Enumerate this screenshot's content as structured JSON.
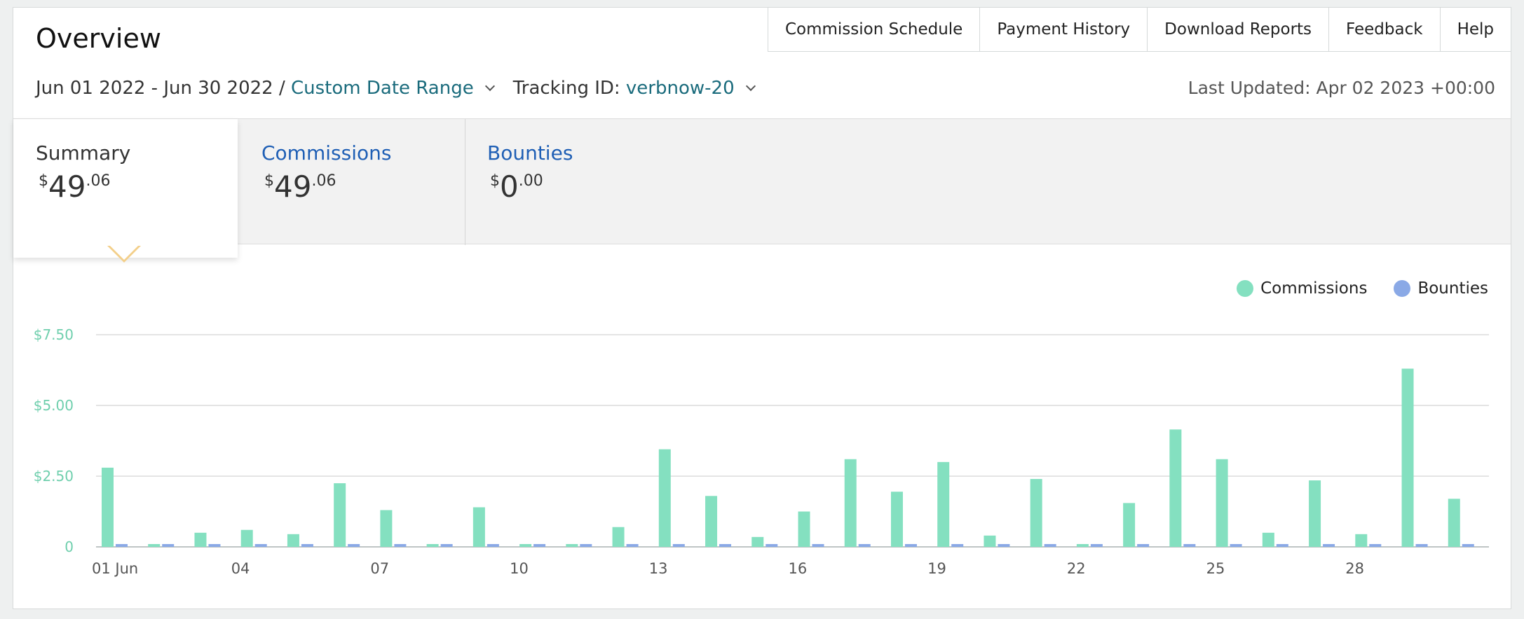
{
  "header": {
    "title": "Overview",
    "nav": [
      "Commission Schedule",
      "Payment History",
      "Download Reports",
      "Feedback",
      "Help"
    ],
    "date_range": "Jun 01 2022 - Jun 30 2022 /",
    "date_mode": "Custom Date Range",
    "tracking_label": "Tracking ID:",
    "tracking_id": "verbnow-20",
    "last_updated": "Last Updated: Apr 02 2023 +00:00"
  },
  "tabs": [
    {
      "label": "Summary",
      "currency": "$",
      "whole": "49",
      "cents": ".06"
    },
    {
      "label": "Commissions",
      "currency": "$",
      "whole": "49",
      "cents": ".06"
    },
    {
      "label": "Bounties",
      "currency": "$",
      "whole": "0",
      "cents": ".00"
    }
  ],
  "legend": {
    "commissions": "Commissions",
    "bounties": "Bounties"
  },
  "colors": {
    "commissions": "#84e0c0",
    "bounties": "#8aa9e6",
    "ytick": "#6fcfad",
    "accent_link": "#1a6b7c"
  },
  "chart_data": {
    "type": "bar",
    "x_labels": {
      "1": "01 Jun",
      "4": "04",
      "7": "07",
      "10": "10",
      "13": "13",
      "16": "16",
      "19": "19",
      "22": "22",
      "25": "25",
      "28": "28"
    },
    "yticks": [
      "0",
      "$2.50",
      "$5.00",
      "$7.50"
    ],
    "ylim": [
      0,
      7.5
    ],
    "series": [
      {
        "name": "Commissions",
        "values": [
          2.8,
          0.1,
          0.5,
          0.6,
          0.45,
          2.25,
          1.3,
          0.1,
          1.4,
          0.1,
          0.1,
          0.7,
          3.45,
          1.8,
          0.35,
          1.25,
          3.1,
          1.95,
          3.0,
          0.4,
          2.4,
          0.1,
          1.55,
          4.15,
          3.1,
          0.5,
          2.35,
          0.45,
          6.3,
          1.7
        ]
      },
      {
        "name": "Bounties",
        "values": [
          0.1,
          0.1,
          0.1,
          0.1,
          0.1,
          0.1,
          0.1,
          0.1,
          0.1,
          0.1,
          0.1,
          0.1,
          0.1,
          0.1,
          0.1,
          0.1,
          0.1,
          0.1,
          0.1,
          0.1,
          0.1,
          0.1,
          0.1,
          0.1,
          0.1,
          0.1,
          0.1,
          0.1,
          0.1,
          0.1
        ]
      }
    ]
  }
}
